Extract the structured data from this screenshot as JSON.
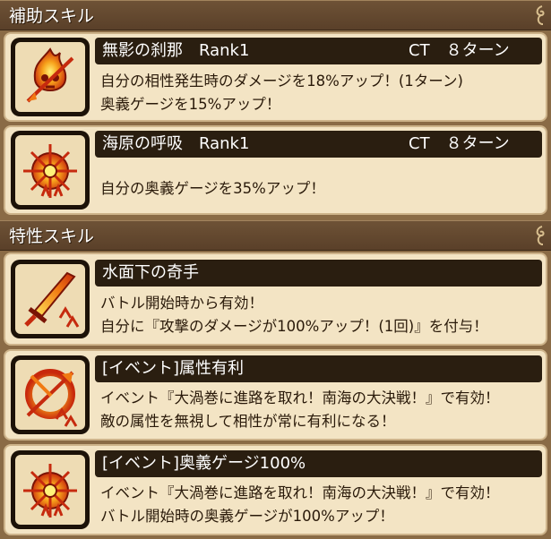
{
  "support_header": "補助スキル",
  "trait_header": "特性スキル",
  "support_skills": [
    {
      "name": "無影の刹那　Rank1",
      "ct": "CT　８ターン",
      "icon": "fire-skull-icon",
      "desc": [
        "自分の相性発生時のダメージを18%アップ！(1ターン)",
        "奥義ゲージを15%アップ！"
      ]
    },
    {
      "name": "海原の呼吸　Rank1",
      "ct": "CT　８ターン",
      "icon": "flame-compass-icon",
      "desc": [
        "自分の奥義ゲージを35%アップ！"
      ]
    }
  ],
  "trait_skills": [
    {
      "name": "水面下の奇手",
      "icon": "flame-sword-icon",
      "desc": [
        "バトル開始時から有効！",
        "自分に『攻撃のダメージが100%アップ！(1回)』を付与！"
      ]
    },
    {
      "name": "[イベント]属性有利",
      "icon": "crossed-arrow-icon",
      "desc": [
        "イベント『大渦巻に進路を取れ！南海の大決戦！』で有効！",
        "敵の属性を無視して相性が常に有利になる！"
      ]
    },
    {
      "name": "[イベント]奥義ゲージ100%",
      "icon": "flame-compass-icon",
      "desc": [
        "イベント『大渦巻に進路を取れ！南海の大決戦！』で有効！",
        "バトル開始時の奥義ゲージが100%アップ！"
      ]
    }
  ]
}
